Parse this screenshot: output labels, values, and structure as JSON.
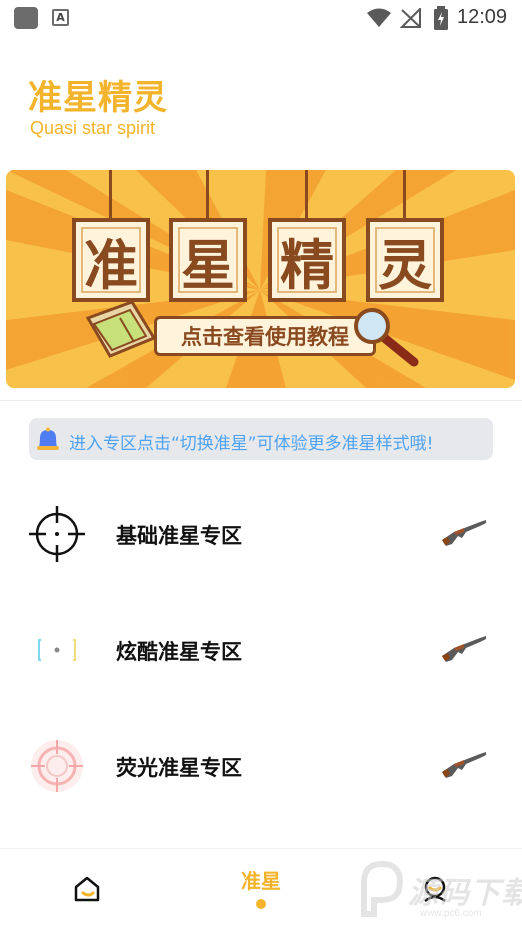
{
  "status_bar": {
    "time": "12:09",
    "icons": [
      "app-icon",
      "text-icon",
      "wifi-icon",
      "no-signal-icon",
      "battery-charging-icon"
    ]
  },
  "header": {
    "title": "准星精灵",
    "subtitle": "Quasi star spirit"
  },
  "banner": {
    "tiles": [
      "准",
      "星",
      "精",
      "灵"
    ],
    "caption": "点击查看使用教程",
    "colors": {
      "background": "#f8c14a",
      "ray": "#f39a2b",
      "frame": "#8a4a1f",
      "paper": "#fff3dc"
    }
  },
  "tip": {
    "icon": "bell-icon",
    "text": "进入专区点击“切换准星”可体验更多准星样式哦!"
  },
  "zones": [
    {
      "label": "基础准星专区",
      "icon": "crosshair-basic-icon",
      "action_icon": "rifle-icon"
    },
    {
      "label": "炫酷准星专区",
      "icon": "crosshair-cool-icon",
      "action_icon": "rifle-icon"
    },
    {
      "label": "荧光准星专区",
      "icon": "crosshair-glow-icon",
      "action_icon": "rifle-icon"
    }
  ],
  "bottom_nav": {
    "items": [
      {
        "icon": "home-icon",
        "label": ""
      },
      {
        "icon": "crosshair-tab",
        "label": "准星",
        "active": true
      },
      {
        "icon": "profile-icon",
        "label": ""
      }
    ],
    "accent": "#f3b32a"
  },
  "watermark": {
    "text": "源码下载",
    "sub": "www.pc6.com"
  }
}
